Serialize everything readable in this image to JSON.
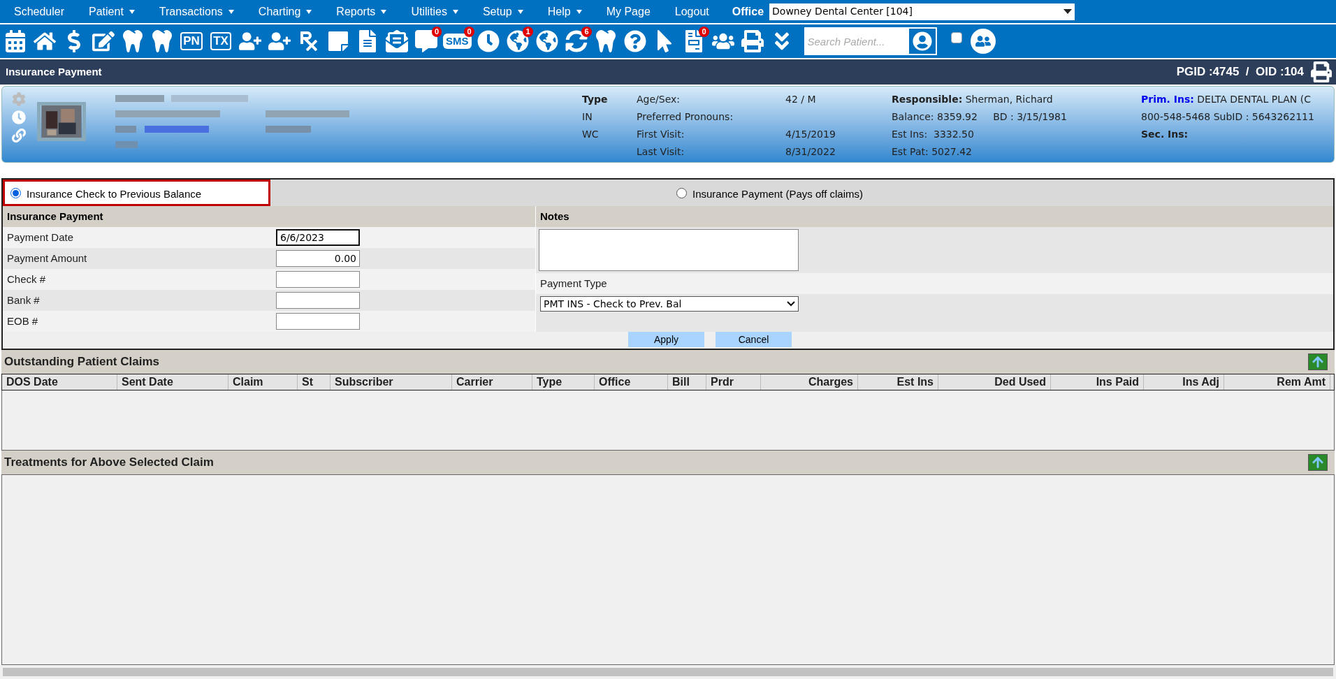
{
  "menu": [
    {
      "label": "Scheduler",
      "dropdown": false
    },
    {
      "label": "Patient",
      "dropdown": true
    },
    {
      "label": "Transactions",
      "dropdown": true
    },
    {
      "label": "Charting",
      "dropdown": true
    },
    {
      "label": "Reports",
      "dropdown": true
    },
    {
      "label": "Utilities",
      "dropdown": true
    },
    {
      "label": "Setup",
      "dropdown": true
    },
    {
      "label": "Help",
      "dropdown": true
    },
    {
      "label": "My Page",
      "dropdown": false
    },
    {
      "label": "Logout",
      "dropdown": false
    }
  ],
  "office": {
    "label": "Office",
    "value": "Downey Dental Center [104]"
  },
  "toolbar": {
    "items": [
      {
        "kind": "calendar"
      },
      {
        "kind": "home"
      },
      {
        "kind": "dollar"
      },
      {
        "kind": "edit"
      },
      {
        "kind": "tooth"
      },
      {
        "kind": "tooth"
      },
      {
        "kind": "boxed",
        "label": "PN"
      },
      {
        "kind": "boxed",
        "label": "TX"
      },
      {
        "kind": "adduser"
      },
      {
        "kind": "adduser"
      },
      {
        "kind": "rx"
      },
      {
        "kind": "note"
      },
      {
        "kind": "document"
      },
      {
        "kind": "mail"
      },
      {
        "kind": "chat",
        "badge": "0"
      },
      {
        "kind": "bubble",
        "label": "SMS",
        "badge": "0"
      },
      {
        "kind": "clock"
      },
      {
        "kind": "globe",
        "badge": "1"
      },
      {
        "kind": "globe"
      },
      {
        "kind": "refresh",
        "badge": "6"
      },
      {
        "kind": "tooth"
      },
      {
        "kind": "question"
      },
      {
        "kind": "cursor"
      },
      {
        "kind": "checklist",
        "badge": "0"
      },
      {
        "kind": "people"
      },
      {
        "kind": "printer"
      },
      {
        "kind": "chevrons"
      }
    ],
    "search": {
      "placeholder": "Search Patient..."
    },
    "checkbox": {
      "checked": false
    }
  },
  "title_bar": {
    "title": "Insurance Payment",
    "ids": "PGID :4745  /  OID :104"
  },
  "patient": {
    "type_heading": "Type",
    "types": [
      "IN",
      "WC"
    ],
    "details": [
      {
        "label": "Age/Sex:",
        "value": "42 / M"
      },
      {
        "label": "Preferred Pronouns:"
      },
      {
        "label": "First Visit:",
        "value": "4/15/2019"
      },
      {
        "label": "Last Visit:",
        "value": "8/31/2022"
      }
    ],
    "responsible": {
      "label": "Responsible:",
      "value": "Sherman, Richard"
    },
    "account": [
      "Balance: 8359.92     BD : 3/15/1981",
      "Est Ins:  3332.50",
      "Est Pat: 5027.42"
    ],
    "primary_ins": {
      "label": "Prim. Ins:",
      "value": "DELTA DENTAL PLAN (C"
    },
    "ins_line": "800-548-5468 SubID : 5643262111",
    "secondary_ins": {
      "label": "Sec. Ins:"
    }
  },
  "form": {
    "options": [
      {
        "label": "Insurance Check to Previous Balance",
        "selected": true
      },
      {
        "label": "Insurance Payment (Pays off claims)",
        "selected": false
      }
    ],
    "left_title": "Insurance Payment",
    "fields": [
      {
        "label": "Payment Date",
        "value": "6/6/2023",
        "focused": true,
        "kind": "text"
      },
      {
        "label": "Payment Amount",
        "value": "0.00",
        "focused": false,
        "kind": "number"
      },
      {
        "label": "Check #",
        "focused": false,
        "kind": "text"
      },
      {
        "label": "Bank #",
        "focused": false,
        "kind": "text"
      },
      {
        "label": "EOB #",
        "focused": false,
        "kind": "text"
      }
    ],
    "notes_title": "Notes",
    "payment_type": {
      "label": "Payment Type",
      "value": "PMT INS - Check to Prev. Bal"
    },
    "buttons": [
      "Apply",
      "Cancel"
    ]
  },
  "claims": {
    "title": "Outstanding Patient Claims",
    "columns": [
      {
        "label": "DOS Date",
        "kind": "text"
      },
      {
        "label": "Sent Date",
        "kind": "text"
      },
      {
        "label": "Claim",
        "kind": "text"
      },
      {
        "label": "St",
        "kind": "text"
      },
      {
        "label": "Subscriber",
        "kind": "text"
      },
      {
        "label": "Carrier",
        "kind": "text"
      },
      {
        "label": "Type",
        "kind": "text"
      },
      {
        "label": "Office",
        "kind": "text"
      },
      {
        "label": "Bill",
        "kind": "text"
      },
      {
        "label": "Prdr",
        "kind": "text"
      },
      {
        "label": "Charges",
        "kind": "number"
      },
      {
        "label": "Est Ins",
        "kind": "number"
      },
      {
        "label": "Ded Used",
        "kind": "number"
      },
      {
        "label": "Ins Paid",
        "kind": "number"
      },
      {
        "label": "Ins Adj",
        "kind": "number"
      },
      {
        "label": "Rem Amt",
        "kind": "number"
      }
    ]
  },
  "treatments": {
    "title": "Treatments for Above Selected Claim"
  }
}
